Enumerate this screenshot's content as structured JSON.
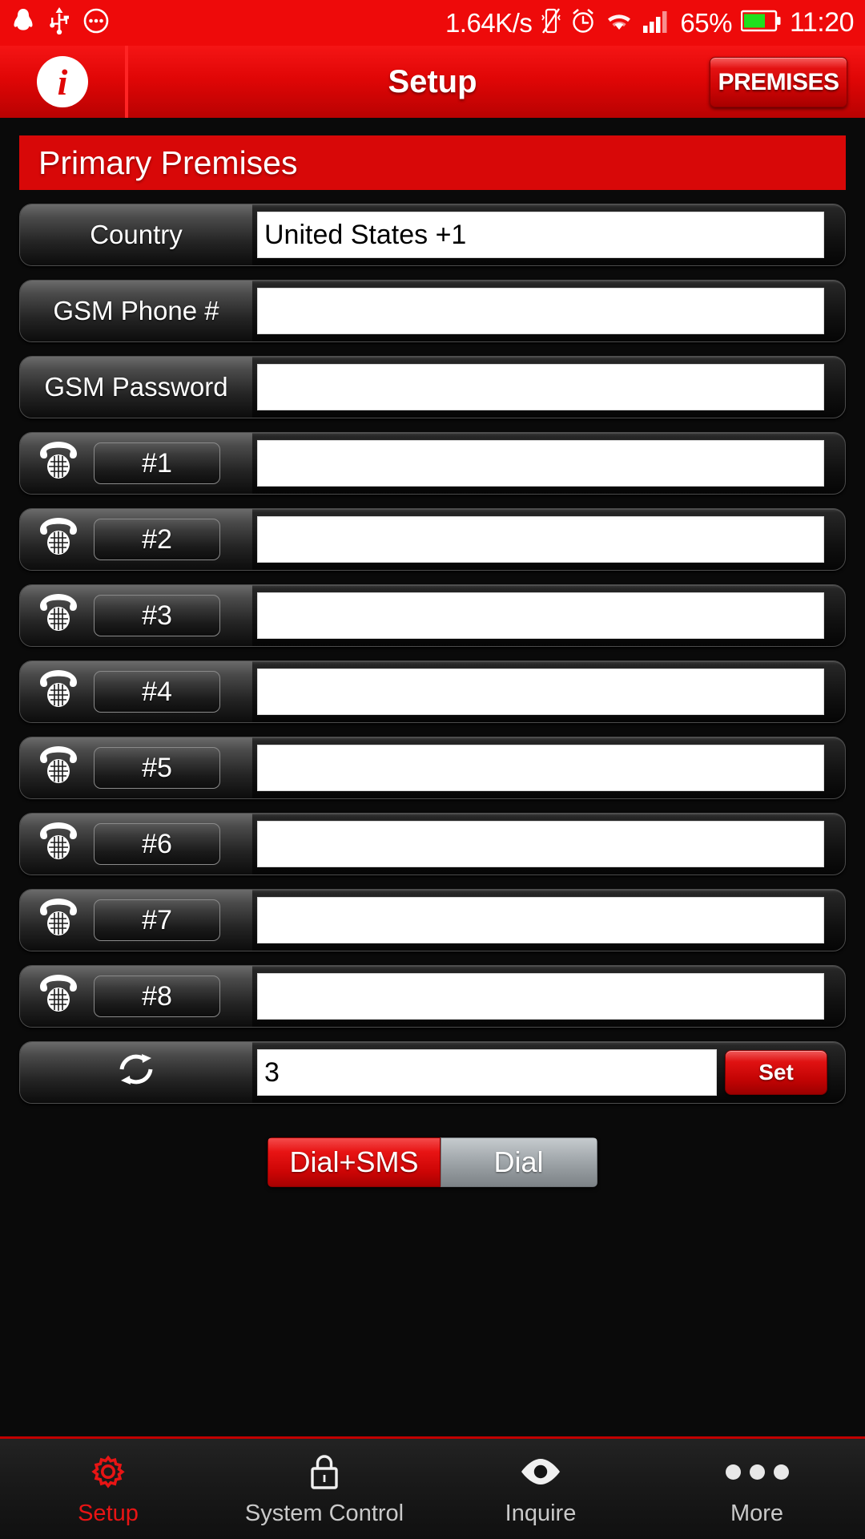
{
  "statusbar": {
    "left_icons": [
      "qq-penguin-icon",
      "usb-icon",
      "more-circle-icon"
    ],
    "network_speed": "1.64K/s",
    "right_icons": [
      "vibrate-off-icon",
      "alarm-clock-icon",
      "wifi-icon",
      "signal-bars-icon"
    ],
    "battery_percent": "65%",
    "battery_icon": "battery-icon",
    "battery_color": "#1ee01e",
    "clock": "11:20",
    "background_color": "#ee0a0a"
  },
  "header": {
    "info_icon": "info-icon",
    "info_glyph": "i",
    "title": "Setup",
    "premises_label": "PREMISES",
    "background_color": "#e00606"
  },
  "section": {
    "banner_title": "Primary Premises",
    "banner_color": "#d80808"
  },
  "form": {
    "rows": [
      {
        "label": "Country",
        "value": "United States +1",
        "icon": null
      },
      {
        "label": "GSM Phone #",
        "value": "",
        "icon": null
      },
      {
        "label": "GSM Password",
        "value": "",
        "icon": null
      }
    ],
    "phone_rows": [
      {
        "chip": "#1",
        "value": "",
        "icon": "telephone-icon"
      },
      {
        "chip": "#2",
        "value": "",
        "icon": "telephone-icon"
      },
      {
        "chip": "#3",
        "value": "",
        "icon": "telephone-icon"
      },
      {
        "chip": "#4",
        "value": "",
        "icon": "telephone-icon"
      },
      {
        "chip": "#5",
        "value": "",
        "icon": "telephone-icon"
      },
      {
        "chip": "#6",
        "value": "",
        "icon": "telephone-icon"
      },
      {
        "chip": "#7",
        "value": "",
        "icon": "telephone-icon"
      },
      {
        "chip": "#8",
        "value": "",
        "icon": "telephone-icon"
      }
    ],
    "retry_row": {
      "icon": "refresh-loop-icon",
      "value": "3",
      "set_label": "Set"
    }
  },
  "dial_toggle": {
    "options": [
      {
        "label": "Dial+SMS",
        "active": true
      },
      {
        "label": "Dial",
        "active": false
      }
    ],
    "active_color": "#e81414",
    "inactive_color": "#a7adb1"
  },
  "navbar": {
    "items": [
      {
        "label": "Setup",
        "icon": "gear-icon",
        "active": true
      },
      {
        "label": "System Control",
        "icon": "lock-icon",
        "active": false
      },
      {
        "label": "Inquire",
        "icon": "eye-icon",
        "active": false
      },
      {
        "label": "More",
        "icon": "dots-icon",
        "active": false
      }
    ],
    "active_color": "#e81414",
    "top_border_color": "#c20000"
  }
}
